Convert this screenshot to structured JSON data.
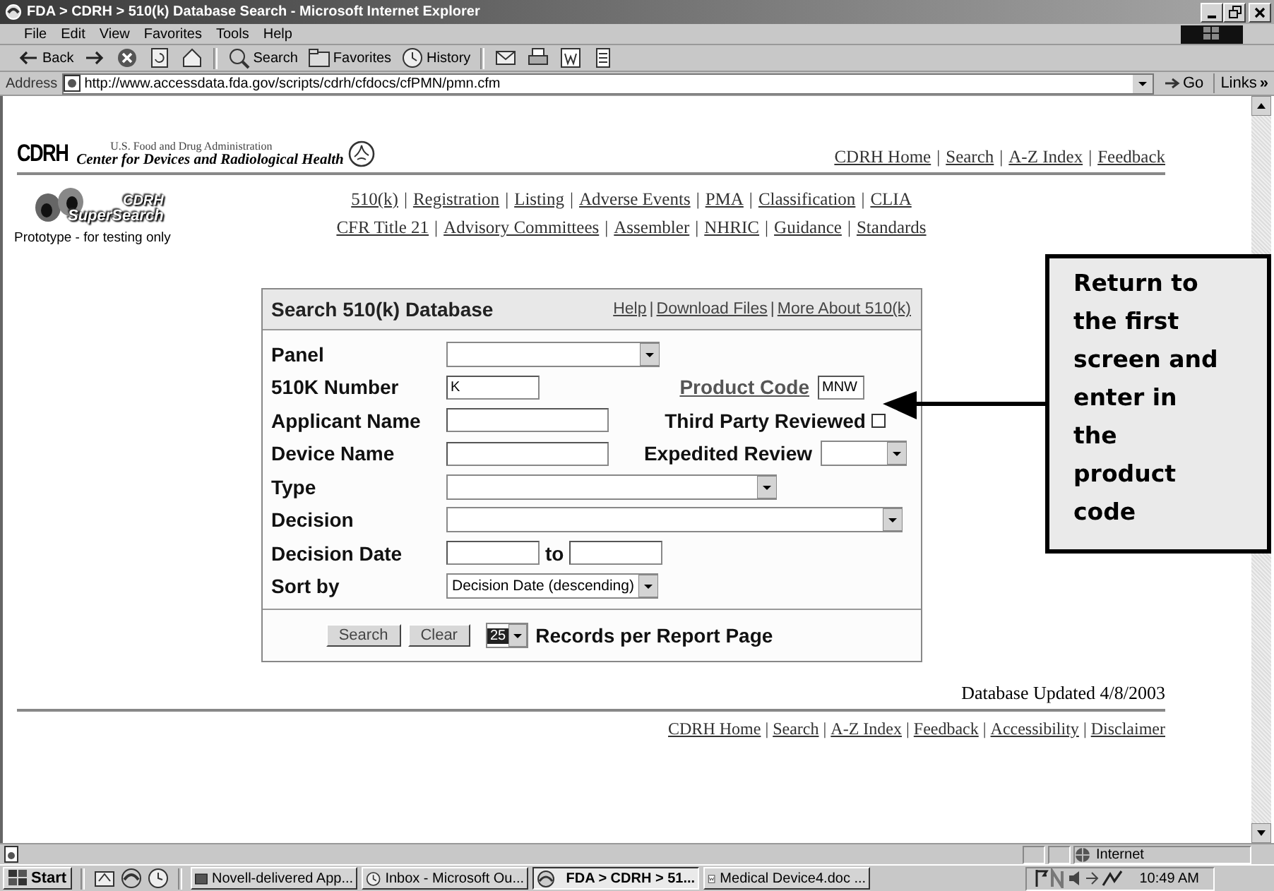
{
  "window": {
    "title": "FDA > CDRH > 510(k) Database Search - Microsoft Internet Explorer"
  },
  "menu_bar": [
    "File",
    "Edit",
    "View",
    "Favorites",
    "Tools",
    "Help"
  ],
  "toolbar": [
    {
      "kind": "back",
      "label": "Back"
    },
    {
      "kind": "forward"
    },
    {
      "kind": "stop"
    },
    {
      "kind": "refresh"
    },
    {
      "kind": "home"
    },
    {
      "kind": "search",
      "label": "Search"
    },
    {
      "kind": "favorites",
      "label": "Favorites"
    },
    {
      "kind": "history",
      "label": "History"
    },
    {
      "kind": "mail"
    },
    {
      "kind": "print"
    },
    {
      "kind": "edit"
    },
    {
      "kind": "discuss"
    }
  ],
  "address_bar": {
    "label": "Address",
    "url": "http://www.accessdata.fda.gov/scripts/cdrh/cfdocs/cfPMN/pmn.cfm",
    "go": "Go",
    "links": "Links",
    "links_chevron": "»"
  },
  "separator": "|",
  "site_header": {
    "logo": "CDRH",
    "agency": "U.S. Food and Drug Administration",
    "center": "Center for Devices and Radiological Health",
    "links": [
      "CDRH Home",
      "Search",
      "A-Z Index",
      "Feedback"
    ]
  },
  "supersearch": {
    "logo_top": "CDRH",
    "logo_bottom": "SuperSearch",
    "note": "Prototype - for testing only"
  },
  "nav_links": [
    [
      "510(k)",
      "Registration",
      "Listing",
      "Adverse Events",
      "PMA",
      "Classification",
      "CLIA"
    ],
    [
      "CFR Title 21",
      "Advisory Committees",
      "Assembler",
      "NHRIC",
      "Guidance",
      "Standards"
    ]
  ],
  "search_form": {
    "title": "Search 510(k) Database",
    "links": [
      "Help",
      "Download Files",
      "More About 510(k)"
    ],
    "rows": [
      {
        "label": "Panel",
        "controls": [
          {
            "kind": "select"
          }
        ]
      },
      {
        "label": "510K Number",
        "controls": [
          {
            "kind": "text",
            "value": "K"
          },
          {
            "kind": "link",
            "text": "Product Code"
          },
          {
            "kind": "text",
            "value": "MNW"
          }
        ]
      },
      {
        "label": "Applicant Name",
        "controls": [
          {
            "kind": "text"
          },
          {
            "kind": "label",
            "text": "Third Party Reviewed"
          },
          {
            "kind": "checkbox",
            "checked": false
          }
        ]
      },
      {
        "label": "Device Name",
        "controls": [
          {
            "kind": "text"
          },
          {
            "kind": "label",
            "text": "Expedited Review"
          },
          {
            "kind": "select"
          }
        ]
      },
      {
        "label": "Type",
        "controls": [
          {
            "kind": "select"
          }
        ]
      },
      {
        "label": "Decision",
        "controls": [
          {
            "kind": "select"
          }
        ]
      },
      {
        "label": "Decision Date",
        "controls": [
          {
            "kind": "text"
          },
          {
            "kind": "label",
            "text": "to"
          },
          {
            "kind": "text"
          }
        ]
      },
      {
        "label": "Sort by",
        "controls": [
          {
            "kind": "select",
            "value": "Decision Date (descending)"
          }
        ]
      }
    ],
    "buttons": [
      "Search",
      "Clear"
    ],
    "records_value": "25",
    "records_label": "Records per Report Page"
  },
  "updated": "Database Updated 4/8/2003",
  "footer_links": [
    "CDRH Home",
    "Search",
    "A-Z Index",
    "Feedback",
    "Accessibility",
    "Disclaimer"
  ],
  "callout": {
    "text": "Return to the first screen and enter in the product code"
  },
  "status_bar": {
    "zone": "Internet"
  },
  "taskbar": {
    "start": "Start",
    "quick_launch": [
      {
        "kind": "desktop"
      },
      {
        "kind": "browser"
      },
      {
        "kind": "clock"
      }
    ],
    "tasks": [
      {
        "kind": "app",
        "label": "Novell-delivered App...",
        "selected": false
      },
      {
        "kind": "clock",
        "label": "Inbox - Microsoft Ou...",
        "selected": false
      },
      {
        "kind": "browser",
        "label": "FDA > CDRH > 51...",
        "selected": true
      },
      {
        "kind": "doc",
        "label": "Medical Device4.doc ...",
        "selected": false
      }
    ],
    "time": "10:49 AM"
  }
}
